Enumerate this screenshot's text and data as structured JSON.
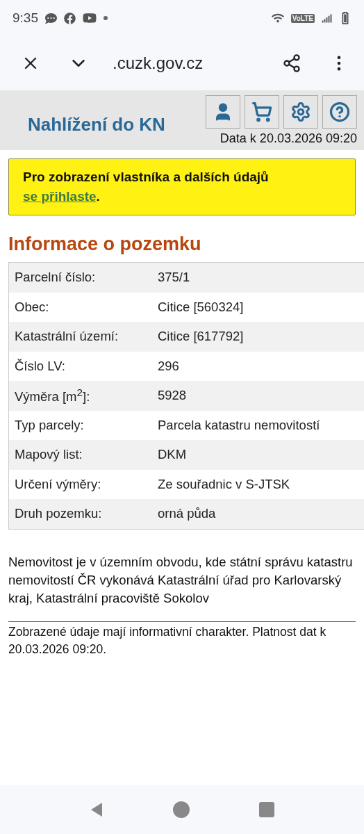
{
  "status_bar": {
    "time": "9:35",
    "network": "VoLTE"
  },
  "browser": {
    "url": ".cuzk.gov.cz"
  },
  "header": {
    "title": "Nahlížení do KN",
    "data_date": "Data k 20.03.2026 09:20"
  },
  "notice": {
    "text": "Pro zobrazení vlastníka a dalších údajů ",
    "link": "se přihlaste",
    "end": "."
  },
  "section_title": "Informace o pozemku",
  "table": {
    "rows": [
      {
        "label": "Parcelní číslo:",
        "value": "375/1"
      },
      {
        "label": "Obec:",
        "value": "Citice [560324]"
      },
      {
        "label": "Katastrální území:",
        "value": "Citice [617792]"
      },
      {
        "label": "Číslo LV:",
        "value": "296"
      },
      {
        "label": "Výměra [m$^{2}$]:",
        "value": "5928"
      },
      {
        "label": "Typ parcely:",
        "value": "Parcela katastru nemovitostí"
      },
      {
        "label": "Mapový list:",
        "value": "DKM"
      },
      {
        "label": "Určení výměry:",
        "value": "Ze souřadnic v S-JTSK"
      },
      {
        "label": "Druh pozemku:",
        "value": "orná půda"
      }
    ]
  },
  "office_note": "Nemovitost je v územním obvodu, kde státní správu katastru nemovitostí ČR vykonává Katastrální úřad pro Karlovarský kraj, Katastrální pracoviště Sokolov",
  "footnote": "Zobrazené údaje mají informativní charakter. Platnost dat k 20.03.2026 09:20."
}
